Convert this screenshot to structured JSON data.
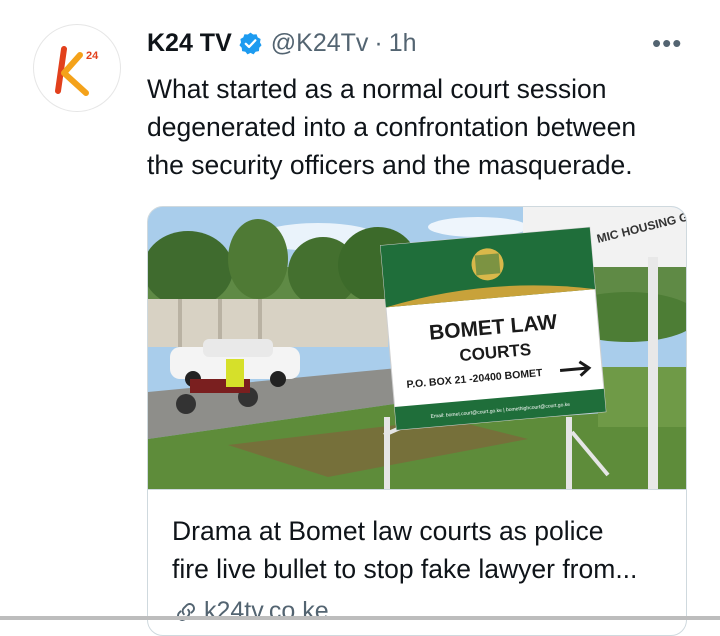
{
  "tweet": {
    "author_name": "K24 TV",
    "handle": "@K24Tv",
    "separator": "·",
    "time": "1h",
    "more_label": "•••",
    "avatar_logo_text": "k24",
    "text_lines": [
      "What started as a normal court session",
      "degenerated into a confrontation between",
      "the security officers and the masquerade."
    ]
  },
  "card": {
    "title_lines": [
      "Drama at Bomet law courts as police",
      "fire live bullet to stop fake lawyer from..."
    ],
    "domain": "k24tv.co.ke",
    "image": {
      "sign_title": "BOMET LAW",
      "sign_subtitle": "COURTS",
      "sign_address": "P.O. BOX 21 -20400 BOMET",
      "sign_emails": "Email: bomet.court@court.go.ke | bomethighcourt@court.go.ke",
      "background_sign_text": "MIC HOUSING GROUP"
    }
  },
  "colors": {
    "accent": "#1d9bf0",
    "text": "#0f1419",
    "muted": "#536471",
    "sign_green": "#1f6e3a"
  },
  "icons": [
    "verified-badge-icon",
    "more-options-icon",
    "link-icon"
  ]
}
